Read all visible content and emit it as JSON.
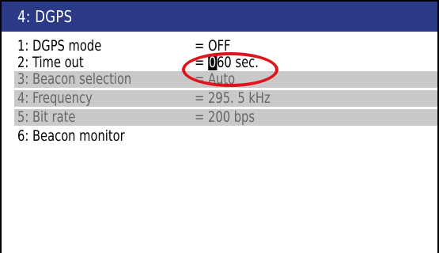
{
  "header": {
    "title": "4: DGPS"
  },
  "menu": {
    "items": [
      {
        "label": "1: DGPS mode",
        "value": "= OFF",
        "disabled": false
      },
      {
        "label": "2: Time out",
        "value_prefix": "= ",
        "value_cursor": "0",
        "value_rest": "60 sec.",
        "disabled": false
      },
      {
        "label": "3: Beacon selection",
        "value": "= Auto",
        "disabled": true
      },
      {
        "label": "4: Frequency",
        "value": "= 295. 5 kHz",
        "disabled": true
      },
      {
        "label": "5: Bit rate",
        "value": "= 200 bps",
        "disabled": true
      },
      {
        "label": "6: Beacon monitor",
        "value": "",
        "disabled": false
      }
    ]
  },
  "colors": {
    "title_bar": "#2b3a86",
    "disabled_row": "#c9c9c9",
    "highlight": "#e0141e"
  }
}
